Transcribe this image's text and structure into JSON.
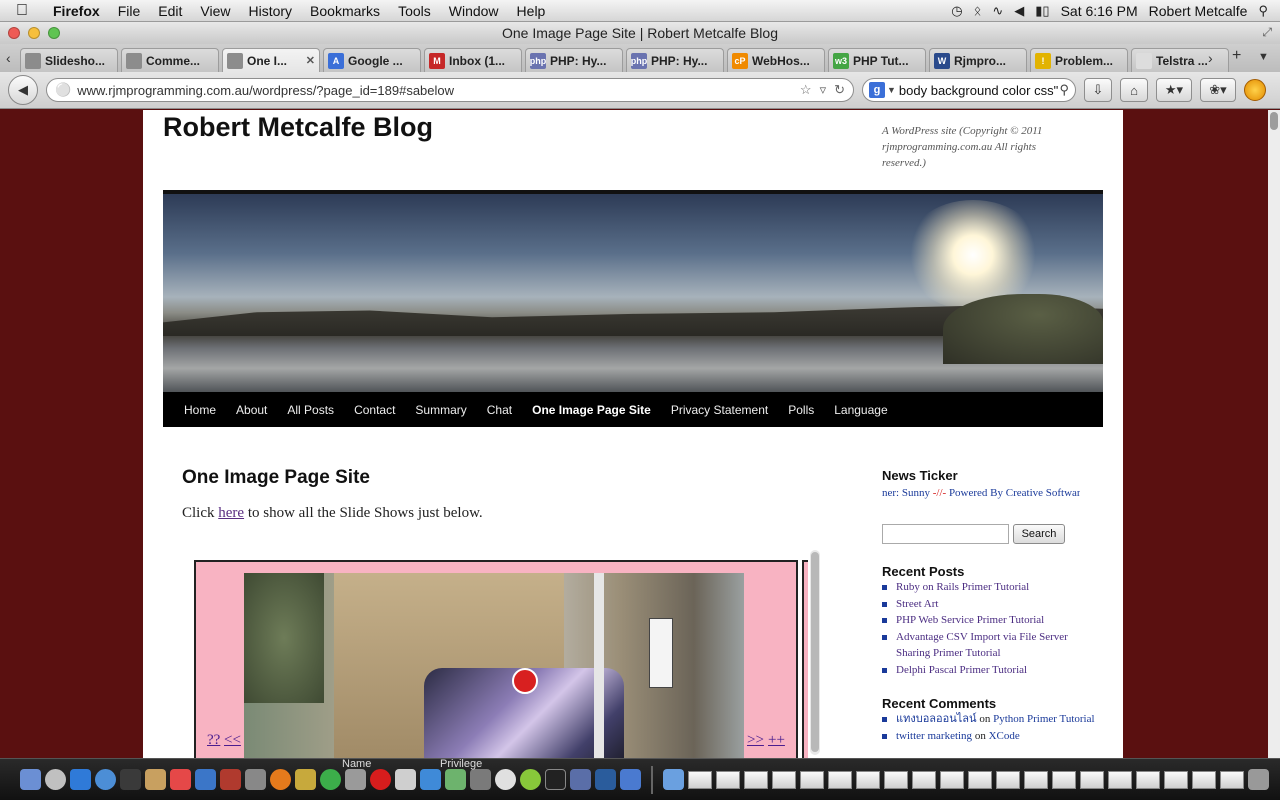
{
  "menubar": {
    "app": "Firefox",
    "items": [
      "File",
      "Edit",
      "View",
      "History",
      "Bookmarks",
      "Tools",
      "Window",
      "Help"
    ],
    "clock": "Sat 6:16 PM",
    "user": "Robert Metcalfe"
  },
  "window": {
    "title": "One Image Page Site | Robert Metcalfe Blog"
  },
  "tabs": [
    {
      "label": "Slidesho...",
      "icon": "page-icon",
      "color": "#8c8c8c"
    },
    {
      "label": "Comme...",
      "icon": "page-icon",
      "color": "#8c8c8c"
    },
    {
      "label": "One I...",
      "icon": "page-icon",
      "color": "#8c8c8c",
      "active": true
    },
    {
      "label": "Google ...",
      "icon": "google-translate-icon",
      "color": "#3b6fd8"
    },
    {
      "label": "Inbox (1...",
      "icon": "gmail-icon",
      "color": "#c62828"
    },
    {
      "label": "PHP: Hy...",
      "icon": "php-icon",
      "color": "#6a73b0"
    },
    {
      "label": "PHP: Hy...",
      "icon": "php-icon",
      "color": "#6a73b0"
    },
    {
      "label": "WebHos...",
      "icon": "cpanel-icon",
      "color": "#f08a00"
    },
    {
      "label": "PHP Tut...",
      "icon": "w3-icon",
      "color": "#44a544"
    },
    {
      "label": "Rjmpro...",
      "icon": "wordpress-icon",
      "color": "#2a4a8c"
    },
    {
      "label": "Problem...",
      "icon": "warning-icon",
      "color": "#e2b300"
    },
    {
      "label": "Telstra ...",
      "icon": "blank-page-icon",
      "color": "#dddddd"
    }
  ],
  "nav": {
    "url": "www.rjmprogramming.com.au/wordpress/?page_id=189#sabelow",
    "search": "body background color css\""
  },
  "site": {
    "title": "Robert Metcalfe Blog",
    "description": "A WordPress site (Copyright © 2011 rjmprogramming.com.au All rights reserved.)",
    "menu": [
      "Home",
      "About",
      "All Posts",
      "Contact",
      "Summary",
      "Chat",
      "One Image Page Site",
      "Privacy Statement",
      "Polls",
      "Language"
    ]
  },
  "entry": {
    "title": "One Image Page Site",
    "text_before": "Click ",
    "link": "here",
    "text_after": " to show all the Slide Shows just below."
  },
  "slideshow": {
    "prev_left": "??",
    "prev": "<<",
    "next": ">>",
    "next_right": "++"
  },
  "sidebar": {
    "ticker_title": "News Ticker",
    "ticker": {
      "part1": "ner: Sunny ",
      "part2": "-//-",
      "part3": " Powered By Creative Software"
    },
    "search_button": "Search",
    "recent_posts_title": "Recent Posts",
    "recent_posts": [
      "Ruby on Rails Primer Tutorial",
      "Street Art",
      "PHP Web Service Primer Tutorial",
      "Advantage CSV Import via File Server Sharing Primer Tutorial",
      "Delphi Pascal Primer Tutorial"
    ],
    "recent_comments_title": "Recent Comments",
    "recent_comments": [
      {
        "author": "แทงบอลออนไลน์",
        "on": " on ",
        "post": "Python Primer Tutorial"
      },
      {
        "author": "twitter marketing",
        "on": " on ",
        "post": "XCode"
      }
    ]
  },
  "dock": {
    "label_a": "Name",
    "label_b": "Privilege"
  }
}
